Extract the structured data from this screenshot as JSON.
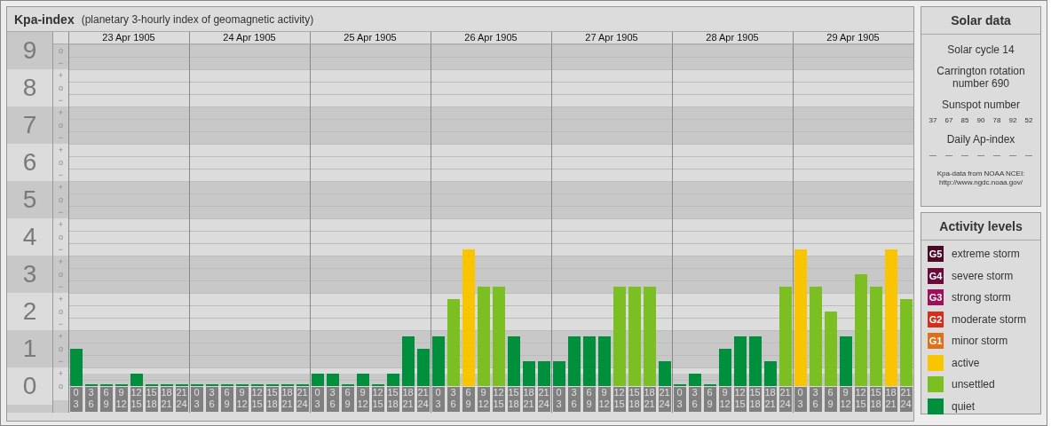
{
  "title": "Kpa-index",
  "subtitle": "(planetary 3-hourly index of geomagnetic activity)",
  "y_axis": {
    "levels": [
      "9",
      "8",
      "7",
      "6",
      "5",
      "4",
      "3",
      "2",
      "1",
      "0"
    ],
    "sublevel_marks": [
      "o",
      "−",
      "+",
      "o",
      "−",
      "+",
      "o",
      "−",
      "+",
      "o",
      "−",
      "+",
      "o",
      "−",
      "+",
      "o",
      "−",
      "+",
      "o",
      "−",
      "+",
      "o",
      "−",
      "+",
      "o",
      "−",
      "+",
      "o"
    ]
  },
  "days": [
    {
      "date": "23 Apr 1905",
      "slots": [
        {
          "label": "0 3",
          "level": 0.111,
          "color": "#008f3c"
        },
        {
          "label": "3 6",
          "level": 0,
          "color": "#008f3c"
        },
        {
          "label": "6 9",
          "level": 0,
          "color": "#008f3c"
        },
        {
          "label": "9 12",
          "level": 0,
          "color": "#008f3c"
        },
        {
          "label": "12 15",
          "level": 0.037,
          "color": "#008f3c"
        },
        {
          "label": "15 18",
          "level": 0,
          "color": "#008f3c"
        },
        {
          "label": "18 21",
          "level": 0,
          "color": "#008f3c"
        },
        {
          "label": "21 24",
          "level": 0,
          "color": "#008f3c"
        }
      ]
    },
    {
      "date": "24 Apr 1905",
      "slots": [
        {
          "label": "0 3",
          "level": 0,
          "color": "#008f3c"
        },
        {
          "label": "3 6",
          "level": 0,
          "color": "#008f3c"
        },
        {
          "label": "6 9",
          "level": 0,
          "color": "#008f3c"
        },
        {
          "label": "9 12",
          "level": 0,
          "color": "#008f3c"
        },
        {
          "label": "12 15",
          "level": 0,
          "color": "#008f3c"
        },
        {
          "label": "15 18",
          "level": 0,
          "color": "#008f3c"
        },
        {
          "label": "18 21",
          "level": 0,
          "color": "#008f3c"
        },
        {
          "label": "21 24",
          "level": 0,
          "color": "#008f3c"
        }
      ]
    },
    {
      "date": "25 Apr 1905",
      "slots": [
        {
          "label": "0 3",
          "level": 0.037,
          "color": "#008f3c"
        },
        {
          "label": "3 6",
          "level": 0.037,
          "color": "#008f3c"
        },
        {
          "label": "6 9",
          "level": 0,
          "color": "#008f3c"
        },
        {
          "label": "9 12",
          "level": 0.037,
          "color": "#008f3c"
        },
        {
          "label": "12 15",
          "level": 0,
          "color": "#008f3c"
        },
        {
          "label": "15 18",
          "level": 0.037,
          "color": "#008f3c"
        },
        {
          "label": "18 21",
          "level": 0.148,
          "color": "#008f3c"
        },
        {
          "label": "21 24",
          "level": 0.111,
          "color": "#008f3c"
        }
      ]
    },
    {
      "date": "26 Apr 1905",
      "slots": [
        {
          "label": "0 3",
          "level": 0.148,
          "color": "#008f3c"
        },
        {
          "label": "3 6",
          "level": 0.259,
          "color": "#7bbf22"
        },
        {
          "label": "6 9",
          "level": 0.407,
          "color": "#f9c400"
        },
        {
          "label": "9 12",
          "level": 0.296,
          "color": "#7bbf22"
        },
        {
          "label": "12 15",
          "level": 0.296,
          "color": "#7bbf22"
        },
        {
          "label": "15 18",
          "level": 0.148,
          "color": "#008f3c"
        },
        {
          "label": "18 21",
          "level": 0.074,
          "color": "#008f3c"
        },
        {
          "label": "21 24",
          "level": 0.074,
          "color": "#008f3c"
        }
      ]
    },
    {
      "date": "27 Apr 1905",
      "slots": [
        {
          "label": "0 3",
          "level": 0.074,
          "color": "#008f3c"
        },
        {
          "label": "3 6",
          "level": 0.148,
          "color": "#008f3c"
        },
        {
          "label": "6 9",
          "level": 0.148,
          "color": "#008f3c"
        },
        {
          "label": "9 12",
          "level": 0.148,
          "color": "#008f3c"
        },
        {
          "label": "12 15",
          "level": 0.296,
          "color": "#7bbf22"
        },
        {
          "label": "15 18",
          "level": 0.296,
          "color": "#7bbf22"
        },
        {
          "label": "18 21",
          "level": 0.296,
          "color": "#7bbf22"
        },
        {
          "label": "21 24",
          "level": 0.074,
          "color": "#008f3c"
        }
      ]
    },
    {
      "date": "28 Apr 1905",
      "slots": [
        {
          "label": "0 3",
          "level": 0,
          "color": "#008f3c"
        },
        {
          "label": "3 6",
          "level": 0.037,
          "color": "#008f3c"
        },
        {
          "label": "6 9",
          "level": 0,
          "color": "#008f3c"
        },
        {
          "label": "9 12",
          "level": 0.111,
          "color": "#008f3c"
        },
        {
          "label": "12 15",
          "level": 0.148,
          "color": "#008f3c"
        },
        {
          "label": "15 18",
          "level": 0.148,
          "color": "#008f3c"
        },
        {
          "label": "18 21",
          "level": 0.074,
          "color": "#008f3c"
        },
        {
          "label": "21 24",
          "level": 0.296,
          "color": "#7bbf22"
        }
      ]
    },
    {
      "date": "29 Apr 1905",
      "slots": [
        {
          "label": "0 3",
          "level": 0.407,
          "color": "#f9c400"
        },
        {
          "label": "3 6",
          "level": 0.296,
          "color": "#7bbf22"
        },
        {
          "label": "6 9",
          "level": 0.222,
          "color": "#7bbf22"
        },
        {
          "label": "9 12",
          "level": 0.148,
          "color": "#008f3c"
        },
        {
          "label": "12 15",
          "level": 0.333,
          "color": "#7bbf22"
        },
        {
          "label": "15 18",
          "level": 0.296,
          "color": "#7bbf22"
        },
        {
          "label": "18 21",
          "level": 0.407,
          "color": "#f9c400"
        },
        {
          "label": "21 24",
          "level": 0.259,
          "color": "#7bbf22"
        }
      ]
    }
  ],
  "solar_data": {
    "title": "Solar data",
    "solar_cycle": "Solar cycle 14",
    "carrington": "Carrington rotation number 690",
    "sunspot_title": "Sunspot number",
    "sunspot_numbers": [
      "37",
      "67",
      "85",
      "90",
      "78",
      "92",
      "52"
    ],
    "ap_title": "Daily Ap-index",
    "ap_values": [
      "—",
      "—",
      "—",
      "—",
      "—",
      "—",
      "—"
    ],
    "source_note": "Kpa-data from NOAA NCEI:",
    "source_url": "http://www.ngdc.noaa.gov/"
  },
  "activity_levels": {
    "title": "Activity levels",
    "items": [
      {
        "badge": "G5",
        "label": "extreme storm",
        "color": "#4b0a28"
      },
      {
        "badge": "G4",
        "label": "severe storm",
        "color": "#6b0a3a"
      },
      {
        "badge": "G3",
        "label": "strong storm",
        "color": "#a0105a"
      },
      {
        "badge": "G2",
        "label": "moderate storm",
        "color": "#d42e1c"
      },
      {
        "badge": "G1",
        "label": "minor storm",
        "color": "#e07018"
      },
      {
        "label": "active",
        "color": "#f9c400"
      },
      {
        "label": "unsettled",
        "color": "#7bbf22"
      },
      {
        "label": "quiet",
        "color": "#008f3c"
      }
    ]
  }
}
